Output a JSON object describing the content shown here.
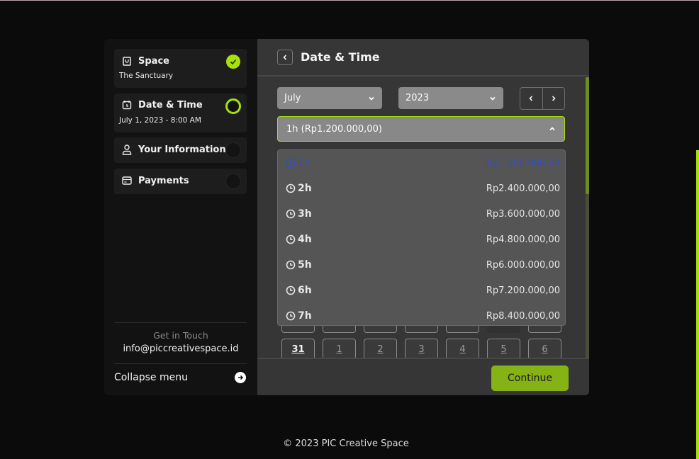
{
  "sidebar": {
    "steps": [
      {
        "title": "Space",
        "subtitle": "The Sanctuary",
        "icon": "shopping-bag-icon",
        "status": "done"
      },
      {
        "title": "Date & Time",
        "subtitle": "July 1, 2023 - 8:00 AM",
        "icon": "calendar-icon",
        "status": "active"
      },
      {
        "title": "Your Information",
        "subtitle": "",
        "icon": "user-icon",
        "status": "pending"
      },
      {
        "title": "Payments",
        "subtitle": "",
        "icon": "credit-card-icon",
        "status": "pending"
      }
    ],
    "contact": {
      "label": "Get in Touch",
      "email": "info@piccreativespace.id"
    },
    "collapse_label": "Collapse menu"
  },
  "main": {
    "title": "Date & Time",
    "month_select": {
      "value": "July"
    },
    "year_select": {
      "value": "2023"
    },
    "duration_select": {
      "value": "1h  (Rp1.200.000,00)"
    },
    "duration_options": [
      {
        "label": "1h",
        "price": "Rp1.200.000,00",
        "selected": true
      },
      {
        "label": "2h",
        "price": "Rp2.400.000,00"
      },
      {
        "label": "3h",
        "price": "Rp3.600.000,00"
      },
      {
        "label": "4h",
        "price": "Rp4.800.000,00"
      },
      {
        "label": "5h",
        "price": "Rp6.000.000,00"
      },
      {
        "label": "6h",
        "price": "Rp7.200.000,00"
      },
      {
        "label": "7h",
        "price": "Rp8.400.000,00"
      }
    ],
    "calendar_last_row": [
      "31",
      "1",
      "2",
      "3",
      "4",
      "5",
      "6"
    ],
    "continue_label": "Continue"
  },
  "footer": {
    "copyright": "© 2023 PIC Creative Space"
  },
  "colors": {
    "accent": "#a6e10a",
    "button": "#85b214",
    "selected_option": "#2f4fc4"
  }
}
